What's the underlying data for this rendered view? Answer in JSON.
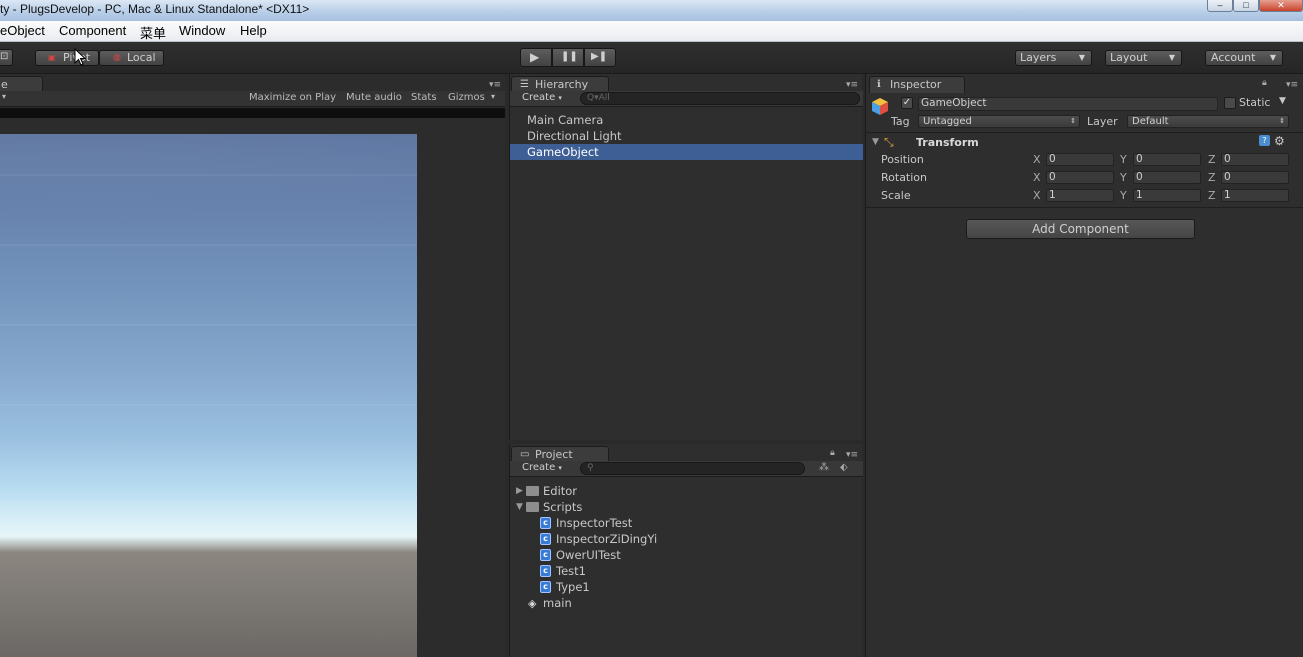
{
  "window": {
    "title": "ty - PlugsDevelop - PC, Mac & Linux Standalone* <DX11>",
    "controls": [
      "–",
      "□",
      "✕"
    ]
  },
  "menu": [
    "eObject",
    "Component",
    "菜单",
    "Window",
    "Help"
  ],
  "toolbar": {
    "pivot": "Pivot",
    "local": "Local",
    "play": "▶",
    "pause": "❚❚",
    "step": "▶❚",
    "layers": "Layers",
    "layout": "Layout",
    "account": "Account"
  },
  "game": {
    "tab_label": "e",
    "options": [
      "Maximize on Play",
      "Mute audio",
      "Stats",
      "Gizmos"
    ]
  },
  "hierarchy": {
    "tab_label": "Hierarchy",
    "create": "Create",
    "search_placeholder": "Q▾All",
    "items": [
      {
        "label": "Main Camera",
        "selected": false
      },
      {
        "label": "Directional Light",
        "selected": false
      },
      {
        "label": "GameObject",
        "selected": true
      }
    ]
  },
  "project": {
    "tab_label": "Project",
    "create": "Create",
    "tree": [
      {
        "label": "Editor",
        "kind": "folder",
        "expanded": false
      },
      {
        "label": "Scripts",
        "kind": "folder",
        "expanded": true
      },
      {
        "label": "InspectorTest",
        "kind": "script"
      },
      {
        "label": "InspectorZiDingYi",
        "kind": "script"
      },
      {
        "label": "OwerUITest",
        "kind": "script"
      },
      {
        "label": "Test1",
        "kind": "script"
      },
      {
        "label": "Type1",
        "kind": "script"
      },
      {
        "label": "main",
        "kind": "scene"
      }
    ]
  },
  "inspector": {
    "tab_label": "Inspector",
    "object_name": "GameObject",
    "static_label": "Static",
    "tag_label": "Tag",
    "tag_value": "Untagged",
    "layer_label": "Layer",
    "layer_value": "Default",
    "component_title": "Transform",
    "rows": [
      {
        "label": "Position",
        "x": "0",
        "y": "0",
        "z": "0"
      },
      {
        "label": "Rotation",
        "x": "0",
        "y": "0",
        "z": "0"
      },
      {
        "label": "Scale",
        "x": "1",
        "y": "1",
        "z": "1"
      }
    ],
    "axis_labels": [
      "X",
      "Y",
      "Z"
    ],
    "add_component": "Add Component"
  },
  "colors": {
    "selection": "#3d5f96",
    "panel_bg": "#2e2e2e"
  }
}
